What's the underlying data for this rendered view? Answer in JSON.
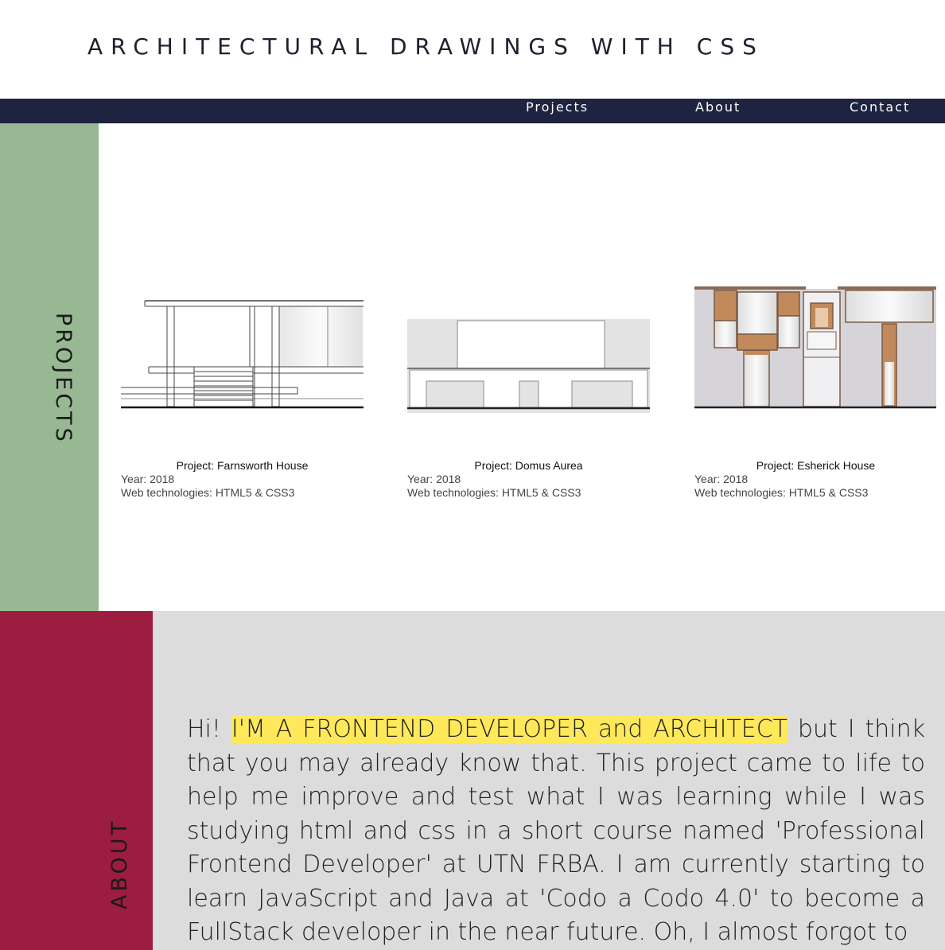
{
  "header": {
    "title": "ARCHITECTURAL DRAWINGS WITH CSS"
  },
  "nav": {
    "items": [
      {
        "label": "Projects"
      },
      {
        "label": "About"
      },
      {
        "label": "Contact"
      }
    ]
  },
  "projects": {
    "section_label": "PROJECTS",
    "cards": [
      {
        "name": "Project: Farnsworth House",
        "year": "Year: 2018",
        "tech": "Web technologies: HTML5 & CSS3"
      },
      {
        "name": "Project: Domus Aurea",
        "year": "Year: 2018",
        "tech": "Web technologies: HTML5 & CSS3"
      },
      {
        "name": "Project: Esherick House",
        "year": "Year: 2018",
        "tech": "Web technologies: HTML5 & CSS3"
      }
    ]
  },
  "about": {
    "section_label": "ABOUT",
    "intro": "Hi! ",
    "highlight": "I'M A FRONTEND DEVELOPER and ARCHITECT",
    "text": " but I think that you may already know that. This project came to life to help me improve and test what I was learning while I was studying html and css in a short course named 'Professional Frontend Developer' at UTN FRBA. I am currently starting to learn JavaScript and Java at 'Codo a Codo 4.0' to become a FullStack developer in the near future. Oh, I almost forgot to"
  },
  "colors": {
    "nav_bg": "#1e2340",
    "projects_accent": "#97b893",
    "about_accent": "#9c1d40",
    "about_bg": "#dcdcdc",
    "highlight": "#ffe95a"
  }
}
